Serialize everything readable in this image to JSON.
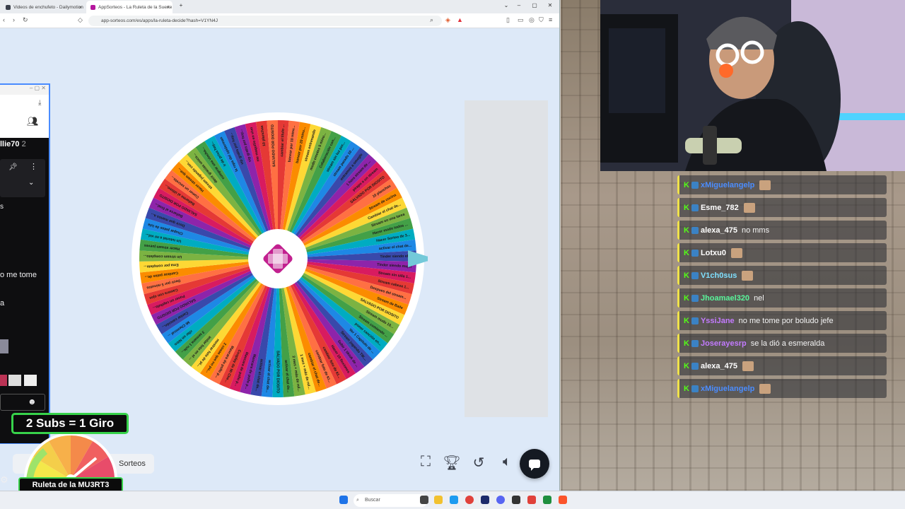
{
  "browser": {
    "tabs": [
      {
        "label": "Videos de enchufeto - Dailymotion"
      },
      {
        "label": "AppSorteos - La Ruleta de la Suerte"
      }
    ],
    "url": "app-sorteos.com/es/apps/la-ruleta-decide?hash=V1YN4J"
  },
  "page": {
    "sorteos_label": "Sorteos"
  },
  "wheel": {
    "segments": [
      "cambiar el titulo ...",
      "banear por 10 minu...",
      "banear por 20 minu...",
      "stream entrenando",
      "modo emotes 5 minu...",
      "Colaboración con...",
      "stream sin luz por...",
      "stream parado 10 ...",
      "entramos a omegle",
      "1 hora stream de ...",
      "pirapo a un stream",
      "SALVADO POR DIOSITO",
      "10 planchas",
      "Stream de cocina",
      "Cambiar el chat de...",
      "Stream en una tarea",
      "Hacer modo todos ...",
      "Hacer Sorteo de 3...",
      "activar el chat de...",
      "Tinder siendo el ...",
      "Tinder siendo mujer",
      "Stream sin silla 1...",
      "Stream cabeza 1...",
      "Despues del stream...",
      "Stream de Baile",
      "SALVADO POR DIOSITO",
      "Stream mudo 10...",
      "Stream comiendo ...",
      "poner canción en...",
      "Ver 1 Capitulo de ...",
      "Stream jugando TIK...",
      "Subir 1 tiktok de ...",
      "Hacer 10 flexiones",
      "cambiar foto de KI...",
      "cambiar foto de KI...",
      "cambiar el chat de...",
      "1 mes + más de rul...",
      "2 mes + más de rul...",
      "activar el chat de...",
      "SALVADO POR DIOSITO",
      "activar el chat de...",
      "activar el chat de...",
      "Mascara de pollo p...",
      "Mascara de pollo p...",
      "Cosplay de Mi Che...",
      "Mascara de pollo p...",
      "2 cosas que no pu...",
      "mostrar foto de pi...",
      "imitar foto en el ...",
      "3 semana 1 rule...",
      "rifar un Nitro",
      "Mi Chemical ...",
      "Cantar canción...",
      "SALVADO POR DIOSITO",
      "Poner un capítulo...",
      "Camera con ojos",
      "Decir por 5 minutos",
      "Cambiar patas de...",
      "Ema por complete...",
      "Un stream completo...",
      "Hacer stream jueves",
      "Un tutorial a mi vid...",
      "Chupar patas de lola",
      "Decir que manos a...",
      "Bañarse al final...",
      "SALVADO POR DIOSITO",
      "Bañarme al último...",
      "Comer un secreto...",
      "Hacer stream que...",
      "stream jugando con...",
      "decir gracias unico...",
      "comprar una vincha...",
      "ir de prisa hay...",
      "la ropa del spiderman",
      "vip gratis por hoy...",
      "vip gratis por hoy...",
      "me maquillo en vivo",
      "10 planchas",
      "SALVADO POR DIOSITO"
    ]
  },
  "popup": {
    "username_fragment": "llie70",
    "count": "2",
    "text1": "o me tome",
    "text2": "a"
  },
  "overlay": {
    "subs_badge": "2 Subs = 1 Giro",
    "ruleta_label": "Ruleta de la MU3RT3"
  },
  "chat": [
    {
      "user": "xMiguelangelp",
      "message": "",
      "color": "#4b8dff"
    },
    {
      "user": "Esme_782",
      "message": "",
      "color": "#ffffff"
    },
    {
      "user": "alexa_475",
      "message": "no mms",
      "color": "#ffffff"
    },
    {
      "user": "Lotxu0",
      "message": "",
      "color": "#ffffff"
    },
    {
      "user": "V1ch0sus",
      "message": "",
      "color": "#7fe0ff"
    },
    {
      "user": "Jhoamael320",
      "message": "nel",
      "color": "#59f59b"
    },
    {
      "user": "YssiJane",
      "message": "no me tome por boludo jefe",
      "color": "#c37bff"
    },
    {
      "user": "Joserayesrp",
      "message": "se la dió a esmeralda",
      "color": "#c37bff"
    },
    {
      "user": "alexa_475",
      "message": "",
      "color": "#ffffff"
    },
    {
      "user": "xMiguelangelp",
      "message": "",
      "color": "#4b8dff"
    }
  ],
  "taskbar": {
    "search_placeholder": "Buscar"
  }
}
